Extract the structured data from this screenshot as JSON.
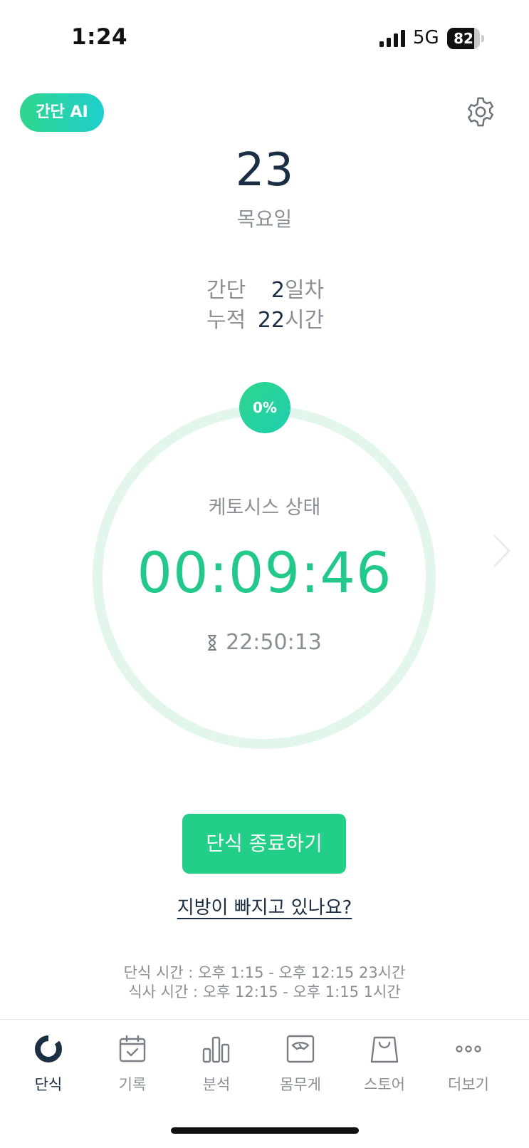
{
  "status_bar": {
    "time": "1:24",
    "network": "5G",
    "battery": 82
  },
  "header": {
    "ai_badge": "간단 AI",
    "settings_icon": "gear-icon"
  },
  "date": {
    "day": "23",
    "weekday": "목요일"
  },
  "stats": [
    {
      "label": "간단",
      "value": "2",
      "unit": "일차"
    },
    {
      "label": "누적",
      "value": "22",
      "unit": "시간"
    }
  ],
  "timer": {
    "progress_percent": "0%",
    "progress_fraction": 0.0,
    "state_label": "케토시스 상태",
    "elapsed": "00:09:46",
    "remaining": "22:50:13",
    "next_icon": "chevron-right-icon"
  },
  "actions": {
    "end_fast": "단식 종료하기",
    "fat_question": "지방이 빠지고 있나요?"
  },
  "schedule": {
    "fasting": "단식 시간 : 오후 1:15 - 오후 12:15 23시간",
    "eating": "식사 시간 : 오후 12:15 - 오후 1:15 1시간"
  },
  "tabs": [
    {
      "label": "단식",
      "icon": "fasting-ring-icon",
      "active": true
    },
    {
      "label": "기록",
      "icon": "calendar-check-icon",
      "active": false
    },
    {
      "label": "분석",
      "icon": "bar-chart-icon",
      "active": false
    },
    {
      "label": "몸무게",
      "icon": "scale-icon",
      "active": false
    },
    {
      "label": "스토어",
      "icon": "shopping-bag-icon",
      "active": false
    },
    {
      "label": "더보기",
      "icon": "more-dots-icon",
      "active": false
    }
  ],
  "colors": {
    "accent_green": "#22c98a",
    "ring_track": "#e3f6ec",
    "text_dark": "#1c2e44",
    "text_gray": "#8a8f96"
  }
}
